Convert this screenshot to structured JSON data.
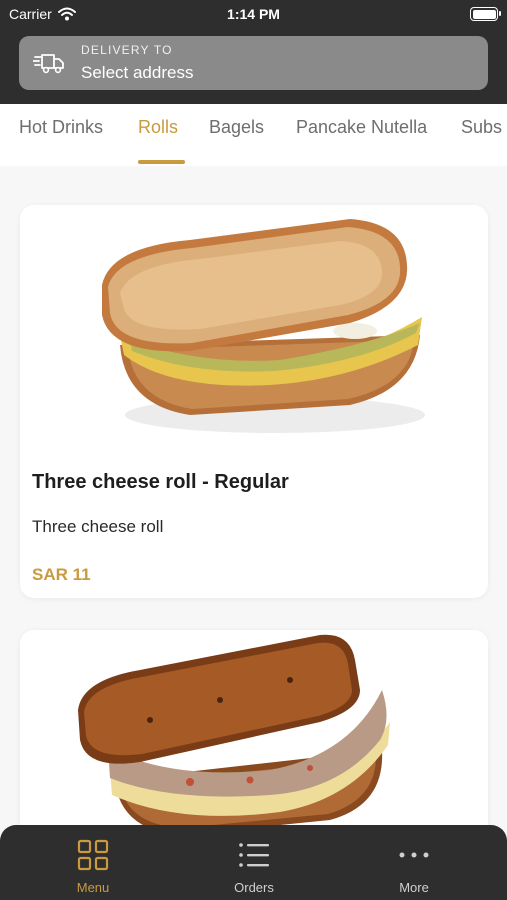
{
  "status_bar": {
    "carrier": "Carrier",
    "time": "1:14 PM"
  },
  "delivery": {
    "label": "DELIVERY TO",
    "address": "Select address",
    "icon": "delivery-truck-icon"
  },
  "tabs": [
    {
      "label": "Hot Drinks",
      "active": false
    },
    {
      "label": "Rolls",
      "active": true
    },
    {
      "label": "Bagels",
      "active": false
    },
    {
      "label": "Pancake Nutella",
      "active": false
    },
    {
      "label": "Subs",
      "active": false
    }
  ],
  "products": [
    {
      "title": "Three cheese roll - Regular",
      "description": "Three cheese roll",
      "price": "SAR 11"
    },
    {
      "title": "",
      "description": "",
      "price": ""
    }
  ],
  "bottom_nav": [
    {
      "label": "Menu",
      "icon": "grid-icon",
      "active": true
    },
    {
      "label": "Orders",
      "icon": "list-icon",
      "active": false
    },
    {
      "label": "More",
      "icon": "more-dots-icon",
      "active": false
    }
  ],
  "colors": {
    "accent": "#c99a3e",
    "header_bg": "#2e2e2e",
    "address_bar_bg": "#8a8a8a",
    "page_bg": "#f7f7f7"
  }
}
